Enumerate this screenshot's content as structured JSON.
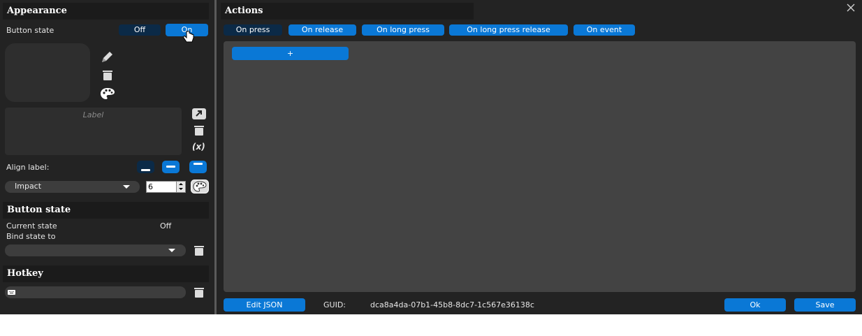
{
  "left": {
    "appearance": {
      "title": "Appearance",
      "button_state_label": "Button state",
      "off_label": "Off",
      "on_label": "On",
      "label_placeholder": "Label",
      "variable_label": "(x)",
      "align_label": "Align label:",
      "font": {
        "selected": "Impact",
        "size": "6"
      }
    },
    "button_state": {
      "title": "Button state",
      "current_state_label": "Current state",
      "current_state_value": "Off",
      "bind_label": "Bind state to",
      "bind_value": ""
    },
    "hotkey": {
      "title": "Hotkey",
      "value": ""
    }
  },
  "actions": {
    "title": "Actions",
    "tabs": [
      "On press",
      "On release",
      "On long press",
      "On long press release",
      "On event"
    ],
    "active_tab": "On press",
    "add_label": "+"
  },
  "footer": {
    "edit_json_label": "Edit JSON",
    "guid_label": "GUID:",
    "guid_value": "dca8a4da-07b1-45b8-8dc7-1c567e36138c",
    "ok_label": "Ok",
    "save_label": "Save"
  },
  "colors": {
    "accent": "#0a78d6",
    "active_tab": "#0b2a47",
    "panel": "#232323",
    "canvas": "#434343"
  },
  "icons": [
    "pencil-icon",
    "trash-icon",
    "palette-icon",
    "open-external-icon",
    "close-icon",
    "keyboard-icon",
    "cursor-hand-icon"
  ]
}
